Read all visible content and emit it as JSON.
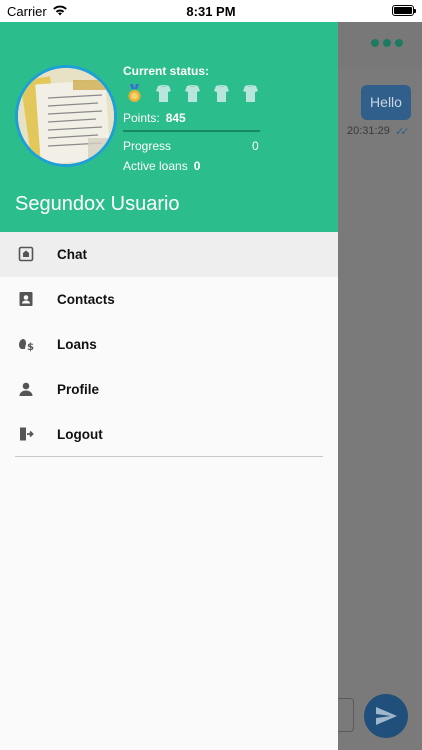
{
  "status_bar": {
    "carrier": "Carrier",
    "time": "8:31 PM"
  },
  "drawer": {
    "current_status_label": "Current status:",
    "points_label": "Points:",
    "points_value": "845",
    "progress_label": "Progress",
    "progress_value": "0",
    "progress_fraction": 0,
    "active_loans_label": "Active loans",
    "active_loans_value": "0",
    "user_name": "Segundox Usuario",
    "medals": [
      {
        "icon": "gold-medal-icon",
        "earned": true
      },
      {
        "icon": "shirt-badge-icon",
        "earned": false
      },
      {
        "icon": "shirt-badge-icon",
        "earned": false
      },
      {
        "icon": "shirt-badge-icon",
        "earned": false
      },
      {
        "icon": "shirt-badge-icon",
        "earned": false
      }
    ],
    "menu": [
      {
        "label": "Chat",
        "icon": "chat-icon",
        "active": true
      },
      {
        "label": "Contacts",
        "icon": "contacts-icon",
        "active": false
      },
      {
        "label": "Loans",
        "icon": "loans-icon",
        "active": false
      },
      {
        "label": "Profile",
        "icon": "profile-icon",
        "active": false
      },
      {
        "label": "Logout",
        "icon": "logout-icon",
        "active": false
      }
    ]
  },
  "background_chat": {
    "message_text": "Hello",
    "message_time": "20:31:29"
  },
  "colors": {
    "header_green": "#2cbd8c",
    "avatar_border": "#1e9fd6",
    "send_button": "#1f4f7a"
  }
}
